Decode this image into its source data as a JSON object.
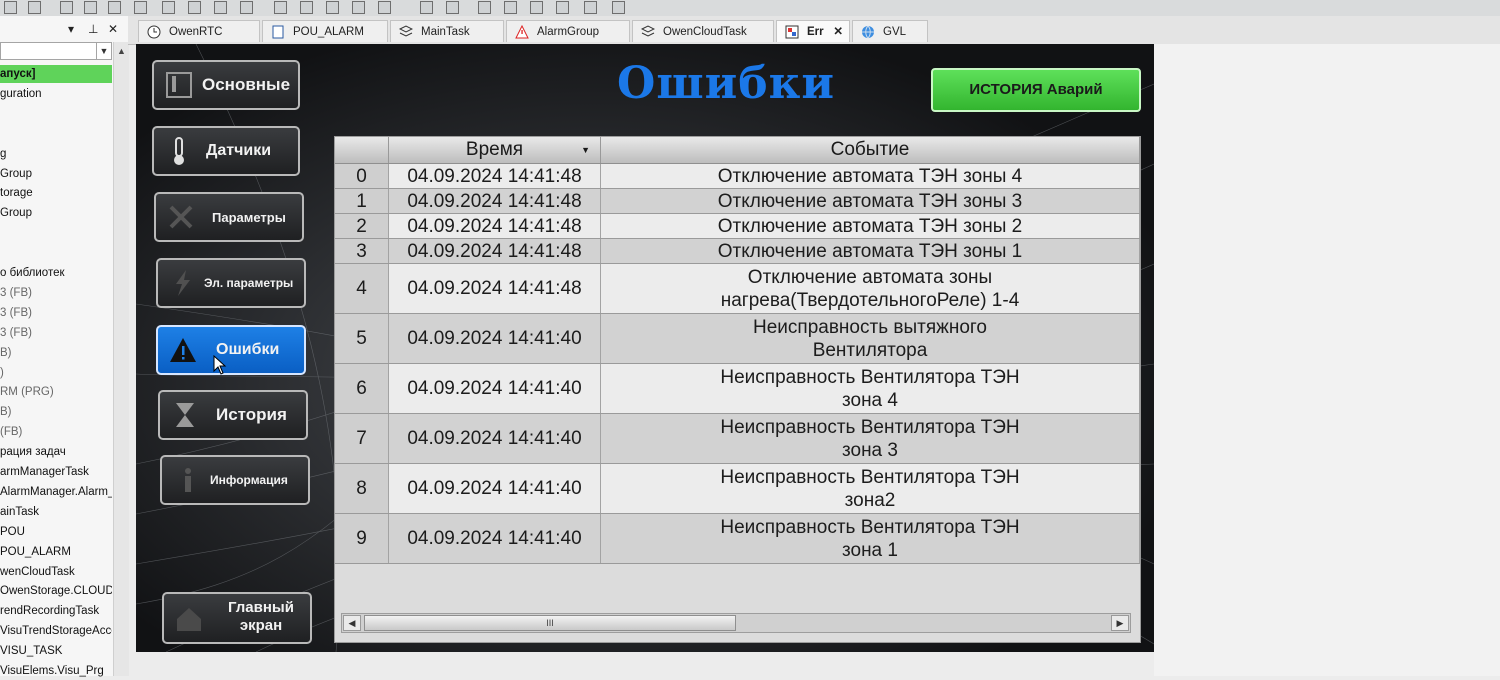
{
  "left_panel": {
    "items": [
      {
        "label": "апуск]",
        "selected": true
      },
      {
        "label": "guration"
      },
      {
        "label": ""
      },
      {
        "label": ""
      },
      {
        "label": "g"
      },
      {
        "label": "Group"
      },
      {
        "label": "torage"
      },
      {
        "label": "Group"
      },
      {
        "label": ""
      },
      {
        "label": ""
      },
      {
        "label": "о библиотек"
      },
      {
        "label": "3 (FB)"
      },
      {
        "label": "3 (FB)"
      },
      {
        "label": "3 (FB)"
      },
      {
        "label": "B)"
      },
      {
        "label": ")"
      },
      {
        "label": "RM (PRG)"
      },
      {
        "label": "B)"
      },
      {
        "label": "(FB)"
      },
      {
        "label": "рация задач"
      },
      {
        "label": "armManagerTask"
      },
      {
        "label": "AlarmManager.Alarm_Prg"
      },
      {
        "label": "ainTask"
      },
      {
        "label": "POU"
      },
      {
        "label": "POU_ALARM"
      },
      {
        "label": "wenCloudTask"
      },
      {
        "label": "OwenStorage.CLOUD_PR"
      },
      {
        "label": "rendRecordingTask"
      },
      {
        "label": "VisuTrendStorageAccess"
      },
      {
        "label": "VISU_TASK"
      },
      {
        "label": "VisuElems.Visu_Prg"
      }
    ]
  },
  "tabs": [
    {
      "label": "OwenRTC",
      "icon": "clock-icon"
    },
    {
      "label": "POU_ALARM",
      "icon": "document-icon"
    },
    {
      "label": "MainTask",
      "icon": "task-icon"
    },
    {
      "label": "AlarmGroup",
      "icon": "warning-icon"
    },
    {
      "label": "OwenCloudTask",
      "icon": "task-icon"
    },
    {
      "label": "Err",
      "icon": "visu-icon",
      "active": true
    },
    {
      "label": "GVL",
      "icon": "globe-icon"
    }
  ],
  "nav": {
    "main": "Основные",
    "sensors": "Датчики",
    "params": "Параметры",
    "el_params": "Эл. параметры",
    "errors": "Ошибки",
    "history": "История",
    "info": "Информация",
    "home_line1": "Главный",
    "home_line2": "экран"
  },
  "header": {
    "title": "Ошибки",
    "history_button": "ИСТОРИЯ Аварий"
  },
  "table": {
    "columns": [
      "Время",
      "Событие"
    ],
    "scroll_thumb_glyph": "III",
    "rows": [
      {
        "index": "0",
        "time": "04.09.2024 14:41:48",
        "event_line1": "Отключение автомата ТЭН зоны 4",
        "event_line2": ""
      },
      {
        "index": "1",
        "time": "04.09.2024 14:41:48",
        "event_line1": "Отключение автомата ТЭН зоны 3",
        "event_line2": ""
      },
      {
        "index": "2",
        "time": "04.09.2024 14:41:48",
        "event_line1": "Отключение автомата ТЭН зоны 2",
        "event_line2": ""
      },
      {
        "index": "3",
        "time": "04.09.2024 14:41:48",
        "event_line1": "Отключение автомата ТЭН зоны 1",
        "event_line2": ""
      },
      {
        "index": "4",
        "time": "04.09.2024 14:41:48",
        "event_line1": "Отключение автомата зоны",
        "event_line2": "нагрева(ТвердотельногоРеле) 1-4"
      },
      {
        "index": "5",
        "time": "04.09.2024 14:41:40",
        "event_line1": "Неисправность вытяжного",
        "event_line2": "Вентилятора"
      },
      {
        "index": "6",
        "time": "04.09.2024 14:41:40",
        "event_line1": "Неисправность Вентилятора ТЭН",
        "event_line2": "зона 4"
      },
      {
        "index": "7",
        "time": "04.09.2024 14:41:40",
        "event_line1": "Неисправность Вентилятора ТЭН",
        "event_line2": "зона 3"
      },
      {
        "index": "8",
        "time": "04.09.2024 14:41:40",
        "event_line1": "Неисправность Вентилятора ТЭН",
        "event_line2": "зона2"
      },
      {
        "index": "9",
        "time": "04.09.2024 14:41:40",
        "event_line1": "Неисправность Вентилятора ТЭН",
        "event_line2": "зона 1"
      }
    ]
  },
  "colors": {
    "accent_blue": "#1b78e8",
    "history_green": "#45c940",
    "selected_tree": "#5fd35a"
  }
}
